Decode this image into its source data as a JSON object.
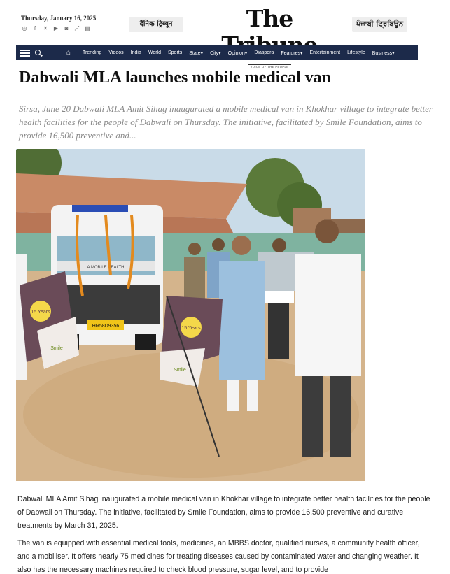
{
  "masthead": {
    "date": "Thursday, January 16, 2025",
    "social_icons": [
      "whatsapp-icon",
      "facebook-icon",
      "x-icon",
      "youtube-icon",
      "instagram-icon",
      "rss-icon",
      "epaper-icon"
    ],
    "hindi_edition": "दैनिक ट्रिब्यून",
    "logo": "The Tribune",
    "logo_tagline": "VOICE OF THE PEOPLE",
    "punjabi_edition": "ਪੰਜਾਬੀ ਟ੍ਰਿਬਿਊਨ"
  },
  "nav": {
    "items": [
      "Trending",
      "Videos",
      "India",
      "World",
      "Sports",
      "State▾",
      "City▾",
      "Opinion▾",
      "Diaspora",
      "Features▾",
      "Entertainment",
      "Lifestyle",
      "Business▾"
    ]
  },
  "article": {
    "headline": "Dabwali MLA launches mobile medical van",
    "standfirst": "Sirsa, June 20 Dabwali MLA Amit Sihag inaugurated a mobile medical van in Khokhar village to integrate better health facilities for the people of Dabwali on Thursday. The initiative, facilitated by Smile Foundation, aims to provide 16,500 preventive and...",
    "photo": {
      "van_plate": "HR58D9356",
      "van_sign": "A MOBILE HEALTH",
      "flag_text": "15 Years",
      "flag_brand": "Smile"
    },
    "paragraphs": [
      "Dabwali MLA Amit Sihag inaugurated a mobile medical van in Khokhar village to integrate better health facilities for the people of Dabwali on Thursday. The initiative, facilitated by Smile Foundation, aims to provide 16,500 preventive and curative treatments by March 31, 2025.",
      "The van is equipped with essential medical tools, medicines, an MBBS doctor, qualified nurses, a community health officer, and a mobiliser. It offers nearly 75 medicines for treating diseases caused by contaminated water and changing weather. It also has the necessary machines required to check blood pressure, sugar level, and to provide"
    ]
  },
  "colors": {
    "nav_bg": "#1c2a4a",
    "pill_bg": "#eeeeee",
    "standfirst": "#888888"
  }
}
